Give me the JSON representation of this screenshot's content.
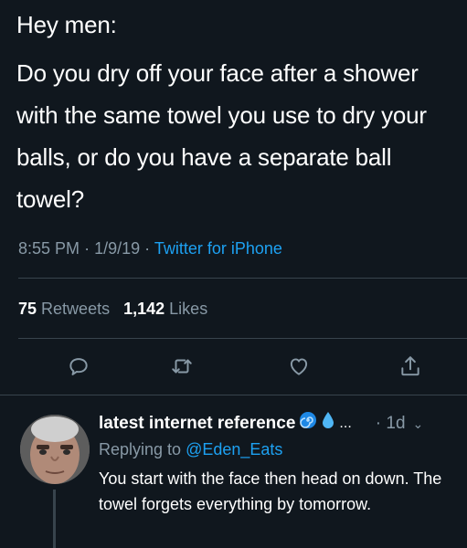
{
  "tweet": {
    "greeting": "Hey men:",
    "body": "Do you dry off your face after a shower with the same towel you use to dry your balls, or do you have a separate ball towel?",
    "time": "8:55 PM",
    "date": "1/9/19",
    "separator": "·",
    "source": "Twitter for iPhone",
    "retweets_count": "75",
    "retweets_label": "Retweets",
    "likes_count": "1,142",
    "likes_label": "Likes"
  },
  "actions": [
    {
      "name": "reply-icon"
    },
    {
      "name": "retweet-icon"
    },
    {
      "name": "like-icon"
    },
    {
      "name": "share-icon"
    }
  ],
  "reply": {
    "display_name": "latest internet reference",
    "emoji_1": "spiral-emoji",
    "emoji_2": "droplet-emoji",
    "ellipsis": "...",
    "time": "· 1d",
    "replying_prefix": "Replying to",
    "replying_handle": "@Eden_Eats",
    "text": "You start with the face then head on down. The towel forgets everything by tomorrow."
  },
  "colors": {
    "background": "#10171e",
    "text": "#ffffff",
    "muted": "#8899a6",
    "accent": "#1da1f2",
    "divider": "#38444d"
  }
}
